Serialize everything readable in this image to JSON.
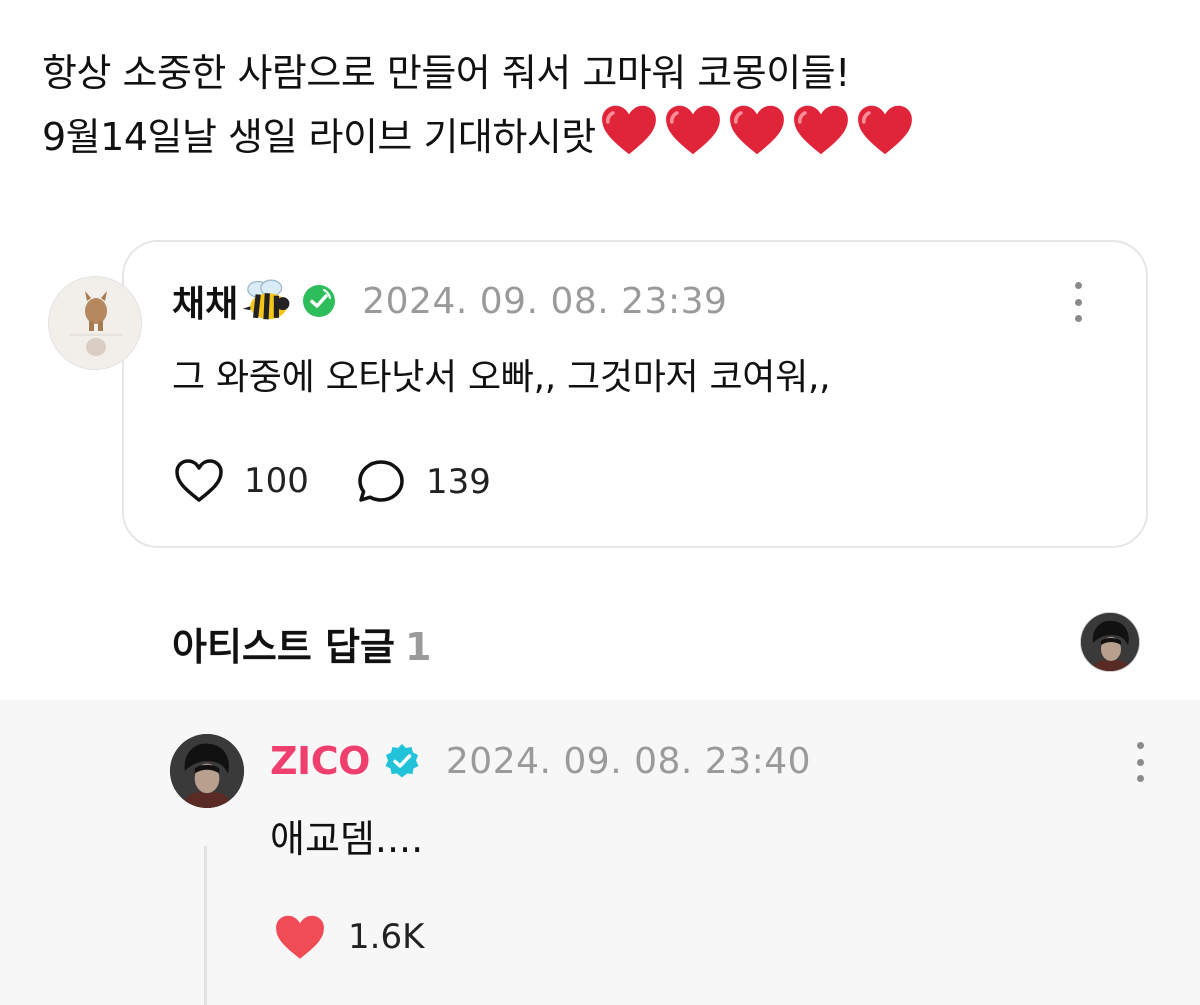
{
  "post": {
    "line1": "항상 소중한 사람으로 만들어 줘서 고마워 코몽이들!",
    "line2": "9월14일날 생일 라이브 기대하시랏",
    "line2_emoji": "red-heart-emoji x5"
  },
  "comment": {
    "author": "채채",
    "author_emoji": "bee-emoji",
    "timestamp": "2024. 09. 08. 23:39",
    "text": "그 와중에 오타낫서 오빠,, 그것마저 코여워,,",
    "likes": "100",
    "replies": "139"
  },
  "artist_reply_section": {
    "title": "아티스트 답글",
    "count": "1"
  },
  "reply": {
    "author": "ZICO",
    "timestamp": "2024. 09. 08. 23:40",
    "text": "애교뎀....",
    "likes": "1.6K"
  },
  "colors": {
    "artist_name": "#ef3f6e",
    "verified_blue": "#22c3d8",
    "verified_green": "#2ebd5b",
    "heart_red": "#ef4c56",
    "timestamp_gray": "#9a9a9a",
    "reply_background": "#f7f7f7"
  }
}
